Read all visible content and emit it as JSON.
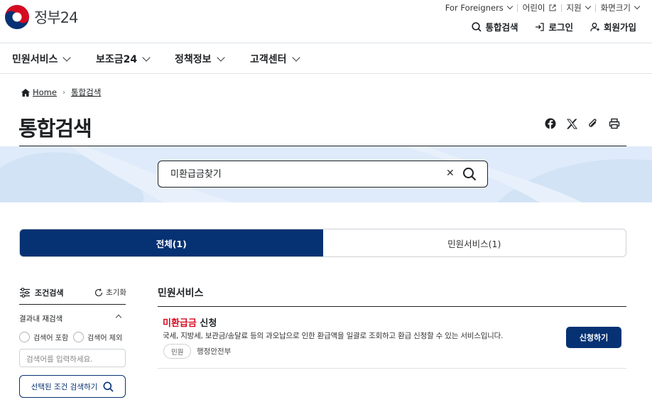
{
  "header": {
    "logo_text": "정부24",
    "util": {
      "foreigners": "For Foreigners",
      "children": "어린이",
      "support": "지원",
      "display_size": "화면크기"
    },
    "tools": {
      "search": "통합검색",
      "login": "로그인",
      "signup": "회원가입"
    }
  },
  "gnb": [
    "민원서비스",
    "보조금24",
    "정책정보",
    "고객센터"
  ],
  "breadcrumb": {
    "home": "Home",
    "current": "통합검색"
  },
  "page_title": "통합검색",
  "search": {
    "value": "미환급금찾기"
  },
  "tabs": [
    {
      "label": "전체(1)",
      "active": true
    },
    {
      "label": "민원서비스(1)",
      "active": false
    }
  ],
  "filter": {
    "title": "조건검색",
    "reset": "초기화",
    "refine_label": "결과내 재검색",
    "include": "검색어 포함",
    "exclude": "검색어 제외",
    "input_placeholder": "검색어를 입력하세요.",
    "apply": "선택된 조건 검색하기"
  },
  "results": {
    "section_title": "민원서비스",
    "items": [
      {
        "title_highlight": "미환급금",
        "title_rest": " 신청",
        "desc": "국세, 지방세, 보관금/송달료 등의 과오납으로 인한 환급액을 일괄로 조회하고 환급 신청할 수 있는 서비스입니다.",
        "badge": "민원",
        "org": "행정안전부",
        "action": "신청하기"
      }
    ]
  },
  "colors": {
    "primary": "#063273",
    "highlight": "#d50c21",
    "band": "#dfebfa"
  }
}
